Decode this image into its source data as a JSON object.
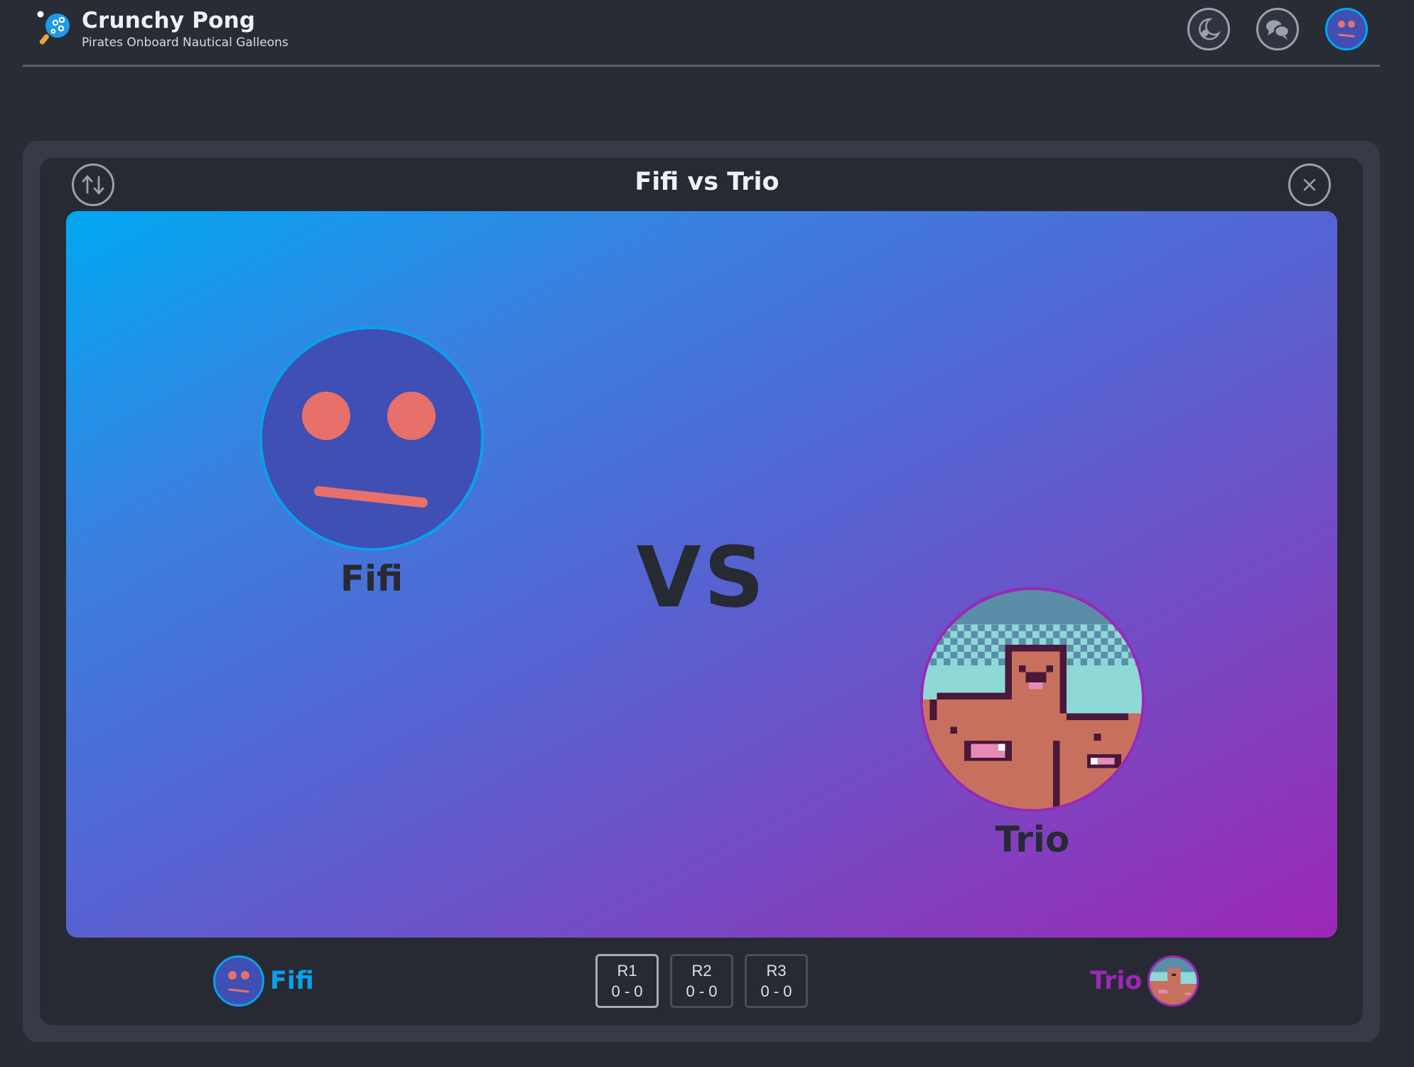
{
  "app": {
    "title": "Crunchy Pong",
    "subtitle": "Pirates Onboard Nautical Galleons"
  },
  "header": {
    "buttons": [
      {
        "name": "theme-toggle",
        "icon": "moon-icon"
      },
      {
        "name": "chat",
        "icon": "chat-bubbles-icon"
      },
      {
        "name": "user-avatar",
        "icon": "neutral-face-icon"
      }
    ]
  },
  "match": {
    "title": "Fifi vs Trio",
    "vs_label": "VS",
    "swap_icon": "swap-arrows-icon",
    "close_icon": "close-icon"
  },
  "players": {
    "p1": {
      "name": "Fifi",
      "color": "#0aa0ec",
      "avatar": "neutral-face-icon"
    },
    "p2": {
      "name": "Trio",
      "color": "#9c27b6",
      "avatar": "pixel-capybara-trio"
    }
  },
  "rounds": [
    {
      "label": "R1",
      "score": "0 - 0",
      "active": true
    },
    {
      "label": "R2",
      "score": "0 - 0",
      "active": false
    },
    {
      "label": "R3",
      "score": "0 - 0",
      "active": false
    }
  ],
  "colors": {
    "background": "#282c35",
    "arena_gradient_start": "#00a8f2",
    "arena_gradient_end": "#9c27b6"
  }
}
